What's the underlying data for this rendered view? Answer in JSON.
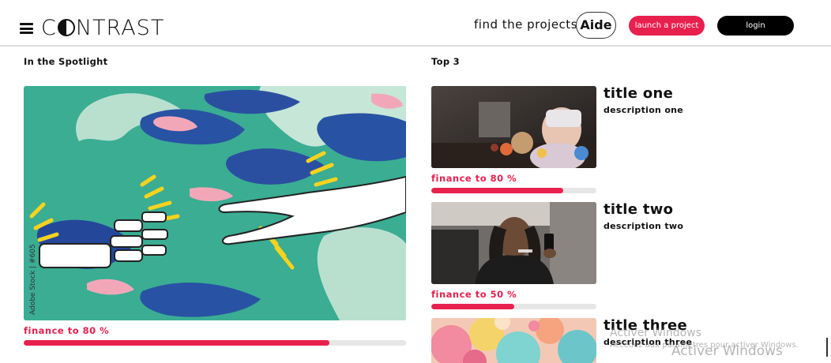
{
  "header": {
    "logo_text_before": "C",
    "logo_text_after": "NTRAST",
    "find_label": "find the projects",
    "aide_label": "Aide",
    "launch_label": "launch a project",
    "login_label": "login"
  },
  "spotlight": {
    "heading": "In the Spotlight",
    "finance_text": "finance to 80 %",
    "progress": 0.8,
    "stock_caption": "Adobe Stock | #605"
  },
  "top3": {
    "heading": "Top 3",
    "items": [
      {
        "title": "title one",
        "description": "description one",
        "finance_text": "finance to 80 %",
        "progress": 0.8
      },
      {
        "title": "title two",
        "description": "description two",
        "finance_text": "finance to 50 %",
        "progress": 0.5
      },
      {
        "title": "title three",
        "description": "description three"
      }
    ]
  },
  "windows_watermark": {
    "line1": "Activer Windows",
    "line2": "Accédez aux paramètres pour activer Windows.",
    "line3": "Activer Windows"
  },
  "colors": {
    "accent": "#e8204e",
    "spotlight_bg": "#3aad93",
    "button_dark": "#000000"
  }
}
